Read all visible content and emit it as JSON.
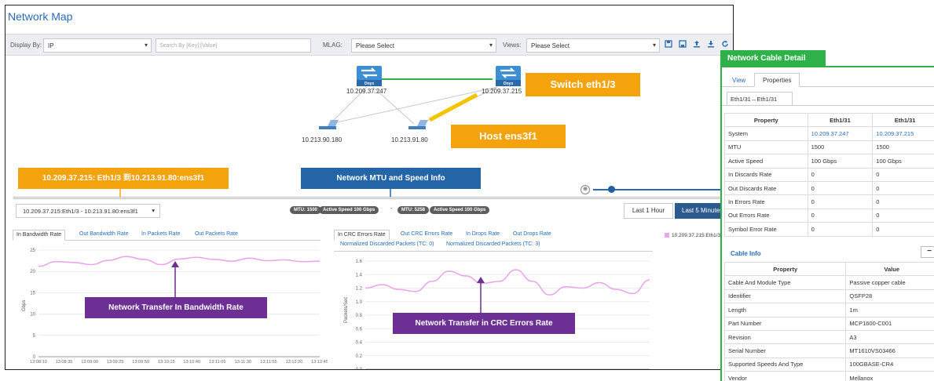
{
  "app": {
    "title": "Network Map"
  },
  "toolbar": {
    "display_by_label": "Display By:",
    "display_by_value": "IP",
    "search_placeholder": "Search By [Key]:[Value]",
    "mlag_label": "MLAG:",
    "mlag_value": "Please Select",
    "views_label": "Views:",
    "views_value": "Please Select",
    "icons": [
      "save-icon",
      "save-as-icon",
      "upload-icon",
      "download-icon",
      "refresh-icon"
    ]
  },
  "topology": {
    "nodes": [
      {
        "label": "10.209.37.247",
        "type": "switch",
        "name": "Onyx"
      },
      {
        "label": "10.209.37.215",
        "type": "switch",
        "name": "Onyx"
      },
      {
        "label": "10.213.90.180",
        "type": "host"
      },
      {
        "label": "10.213.91.80",
        "type": "host"
      }
    ],
    "highlight_color": "#f5c300",
    "link_color": "#2fb14a"
  },
  "callouts": {
    "switch": "Switch eth1/3",
    "host": "Host ens3f1",
    "link": "10.209.37.215: Eth1/3 到10.213.91.80:ens3f1",
    "mtu": "Network MTU and Speed Info",
    "bandwidth": "Network Transfer In Bandwidth Rate",
    "crc": "Network Transfer in CRC Errors Rate"
  },
  "link_select": {
    "value": "10.209.37.215:Eth1/3 - 10.213.91.80:ens3f1"
  },
  "pills": [
    "MTU: 1500",
    "Active Speed 100 Gbps",
    "-",
    "MTU: 5258",
    "Active Speed 100 Gbps"
  ],
  "time_buttons": {
    "hour": "Last 1 Hour",
    "five": "Last 5 Minutes"
  },
  "chart_left": {
    "tabs": [
      "In Bandwidth Rate",
      "Out Bandwidth Rate",
      "In Packets Rate",
      "Out Packets Rate"
    ],
    "ylabel": "Gbps"
  },
  "chart_right": {
    "tabs": [
      "In CRC Errors Rate",
      "Out CRC Errors Rate",
      "In Drops Rate",
      "Out Drops Rate"
    ],
    "tabs2": [
      "Normalized Discarded Packets (TC: 0)",
      "Normalized Discarded Packets (TC: 3)"
    ],
    "ylabel": "Packets/Sec"
  },
  "legend": {
    "series": "10.209.37.215:Eth1/3"
  },
  "chart_data": [
    {
      "type": "line",
      "title": "",
      "xlabel": "",
      "ylabel": "Gbps",
      "ylim": [
        0,
        25
      ],
      "yticks": [
        0,
        5,
        10,
        15,
        20,
        25
      ],
      "xticks": [
        "13:08:10",
        "13:08:35",
        "13:09:00",
        "13:09:25",
        "13:09:50",
        "13:10:15",
        "13:10:40",
        "13:11:05",
        "13:11:30",
        "13:11:55",
        "13:12:20",
        "13:12:45"
      ],
      "series": [
        {
          "name": "10.209.37.215:Eth1/3",
          "color": "#e8a7ea",
          "values": [
            21.2,
            22.3,
            22.1,
            21.6,
            22.6,
            23.5,
            22.8,
            21.6,
            22.9,
            23.3,
            22.8,
            22.4,
            23.1,
            22.5,
            22.7,
            22.3,
            22.4
          ]
        }
      ]
    },
    {
      "type": "line",
      "title": "",
      "xlabel": "",
      "ylabel": "Packets/Sec",
      "ylim": [
        0,
        1.6
      ],
      "yticks": [
        0,
        0.2,
        0.4,
        0.6,
        0.8,
        1.0,
        1.2,
        1.4,
        1.6
      ],
      "xticks": [
        "13:08:10",
        "13:08:35",
        "13:09:00",
        "13:09:25",
        "13:09:50",
        "13:10:15",
        "13:10:40",
        "13:11:05",
        "13:11:30",
        "13:11:55",
        "13:12:20",
        "13:12:45"
      ],
      "series": [
        {
          "name": "10.209.37.215:Eth1/3",
          "color": "#e8a7ea",
          "values": [
            1.2,
            1.25,
            1.18,
            1.15,
            1.3,
            1.45,
            1.38,
            1.27,
            1.3,
            1.47,
            1.3,
            1.1,
            1.22,
            1.2,
            1.28,
            1.18,
            1.12,
            1.32
          ]
        }
      ]
    }
  ],
  "panel": {
    "title": "Network Cable Detail",
    "tabs": [
      "View",
      "Properties"
    ],
    "subtab": "Eth1/31↔Eth1/31",
    "props_header": [
      "Property",
      "Eth1/31",
      "Eth1/31"
    ],
    "props": [
      [
        "System",
        "10.209.37.247",
        "10.209.37.215"
      ],
      [
        "MTU",
        "1500",
        "1500"
      ],
      [
        "Active Speed",
        "100 Gbps",
        "100 Gbps"
      ],
      [
        "In Discards Rate",
        "0",
        "0"
      ],
      [
        "Out Discards Rate",
        "0",
        "0"
      ],
      [
        "In Errors Rate",
        "0",
        "0"
      ],
      [
        "Out Errors Rate",
        "0",
        "0"
      ],
      [
        "Symbol Error Rate",
        "0",
        "0"
      ]
    ],
    "cable_info_label": "Cable Info",
    "collapse": "−",
    "cable_header": [
      "Property",
      "Value"
    ],
    "cable": [
      [
        "Cable And Module Type",
        "Passive copper cable"
      ],
      [
        "Identifier",
        "QSFP28"
      ],
      [
        "Length",
        "1m"
      ],
      [
        "Part Number",
        "MCP1600-C001"
      ],
      [
        "Revision",
        "A3"
      ],
      [
        "Serial Number",
        "MT1610VS03466"
      ],
      [
        "Supported Speeds And Type",
        "100GBASE-CR4"
      ],
      [
        "Vendor",
        "Mellanox"
      ]
    ]
  }
}
